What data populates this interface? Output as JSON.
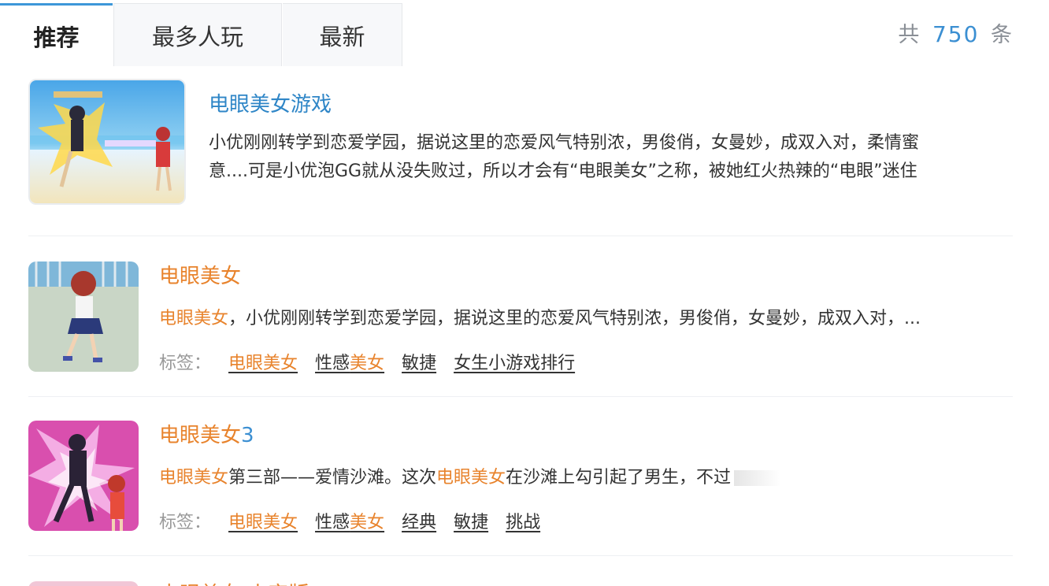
{
  "tabs": [
    {
      "label": "推荐",
      "active": true
    },
    {
      "label": "最多人玩",
      "active": false
    },
    {
      "label": "最新",
      "active": false
    }
  ],
  "count": {
    "prefix": "共",
    "value": "750",
    "suffix": "条"
  },
  "featured": {
    "title": "电眼美女游戏",
    "desc_line1": "小优刚刚转学到恋爱学园，据说这里的恋爱风气特别浓，男俊俏，女曼妙，成双入对，柔情蜜",
    "desc_line2": "意....可是小优泡GG就从没失败过，所以才会有“电眼美女”之称，被她红火热辣的“电眼”迷住"
  },
  "items": [
    {
      "title": "电眼美女",
      "title_suffix": "",
      "desc_hl1": "电眼美女",
      "desc_text1": "，小优刚刚转学到恋爱学园，据说这里的恋爱风气特别浓，男俊俏，女曼妙，成双入对，...",
      "desc_hl2": "",
      "desc_text2": "",
      "tags_label": "标签：",
      "tags": [
        {
          "hl": "电眼美女",
          "pre": "",
          "post": ""
        },
        {
          "hl": "美女",
          "pre": "性感",
          "post": ""
        },
        {
          "hl": "",
          "pre": "敏捷",
          "post": ""
        },
        {
          "hl": "",
          "pre": "女生小游戏排行",
          "post": ""
        }
      ]
    },
    {
      "title": "电眼美女",
      "title_suffix": "3",
      "desc_hl1": "电眼美女",
      "desc_text1": "第三部——爱情沙滩。这次",
      "desc_hl2": "电眼美女",
      "desc_text2": "在沙滩上勾引起了男生，不过",
      "tags_label": "标签：",
      "tags": [
        {
          "hl": "电眼美女",
          "pre": "",
          "post": ""
        },
        {
          "hl": "美女",
          "pre": "性感",
          "post": ""
        },
        {
          "hl": "",
          "pre": "经典",
          "post": ""
        },
        {
          "hl": "",
          "pre": "敏捷",
          "post": ""
        },
        {
          "hl": "",
          "pre": "挑战",
          "post": ""
        }
      ]
    }
  ],
  "partial_item": {
    "title": "电眼美女 小字版"
  }
}
